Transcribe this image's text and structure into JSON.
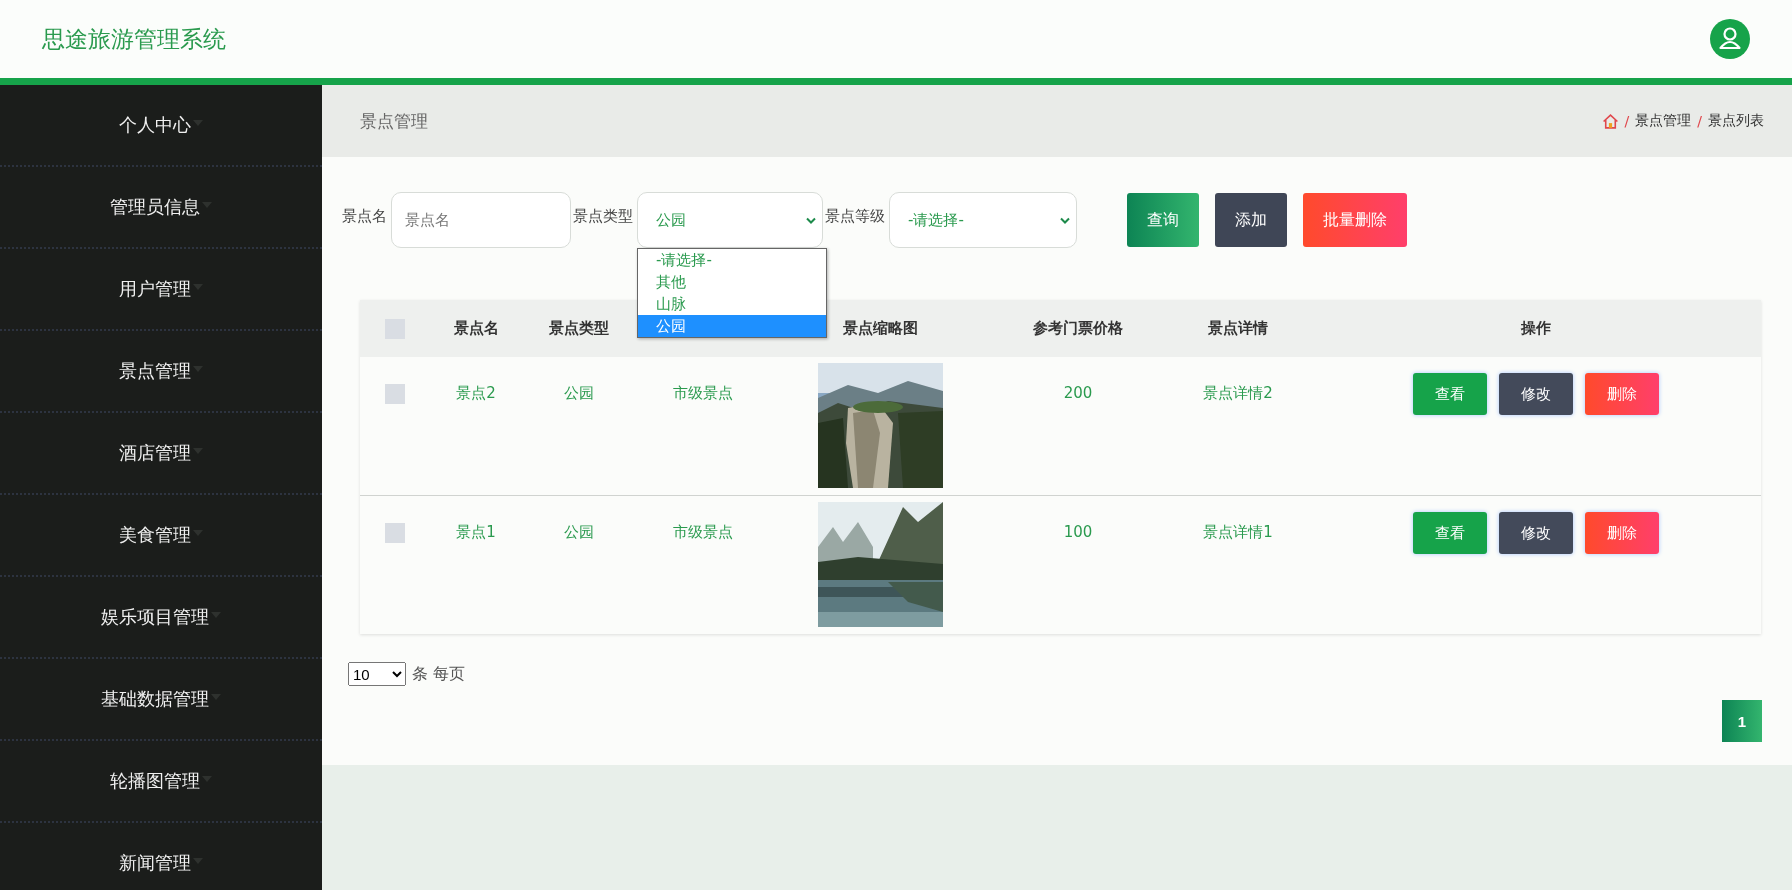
{
  "header": {
    "title": "思途旅游管理系统"
  },
  "sidebar": {
    "items": [
      {
        "label": "个人中心"
      },
      {
        "label": "管理员信息"
      },
      {
        "label": "用户管理"
      },
      {
        "label": "景点管理"
      },
      {
        "label": "酒店管理"
      },
      {
        "label": "美食管理"
      },
      {
        "label": "娱乐项目管理"
      },
      {
        "label": "基础数据管理"
      },
      {
        "label": "轮播图管理"
      },
      {
        "label": "新闻管理"
      }
    ]
  },
  "page_title": "景点管理",
  "breadcrumb": [
    {
      "separator": "/",
      "label": "景点管理"
    },
    {
      "separator": "/",
      "label": "景点列表"
    }
  ],
  "filters": {
    "name": {
      "label": "景点名",
      "placeholder": "景点名"
    },
    "type": {
      "label": "景点类型",
      "value": "公园",
      "expanded": true,
      "options": [
        {
          "label": "-请选择-",
          "selected": false
        },
        {
          "label": "其他",
          "selected": false
        },
        {
          "label": "山脉",
          "selected": false
        },
        {
          "label": "公园",
          "selected": true
        }
      ]
    },
    "level": {
      "label": "景点等级",
      "value": "-请选择-"
    },
    "buttons": [
      {
        "label": "查询",
        "kind": "search"
      },
      {
        "label": "添加",
        "kind": "add"
      },
      {
        "label": "批量删除",
        "kind": "delete"
      }
    ]
  },
  "table": {
    "select_all_checked": false,
    "columns": {
      "name": "景点名",
      "type": "景点类型",
      "thumbnail": "景点缩略图",
      "price": "参考门票价格",
      "detail": "景点详情",
      "actions": "操作"
    },
    "rows": [
      {
        "checked": false,
        "name": "景点2",
        "type": "公园",
        "level": "市级景点",
        "thumbnail": {
          "kind": "picture"
        },
        "price": "200",
        "detail": "景点详情2",
        "actions": [
          {
            "label": "查看",
            "kind": "view"
          },
          {
            "label": "修改",
            "kind": "edit"
          },
          {
            "label": "删除",
            "kind": "delete"
          }
        ]
      },
      {
        "checked": false,
        "name": "景点1",
        "type": "公园",
        "level": "市级景点",
        "thumbnail": {
          "kind": "picture"
        },
        "price": "100",
        "detail": "景点详情1",
        "actions": [
          {
            "label": "查看",
            "kind": "view"
          },
          {
            "label": "修改",
            "kind": "edit"
          },
          {
            "label": "删除",
            "kind": "delete"
          }
        ]
      }
    ]
  },
  "pagination": {
    "page_size": "10",
    "page_size_label": "条 每页",
    "pages": [
      {
        "label": "1",
        "selected": true
      }
    ]
  }
}
